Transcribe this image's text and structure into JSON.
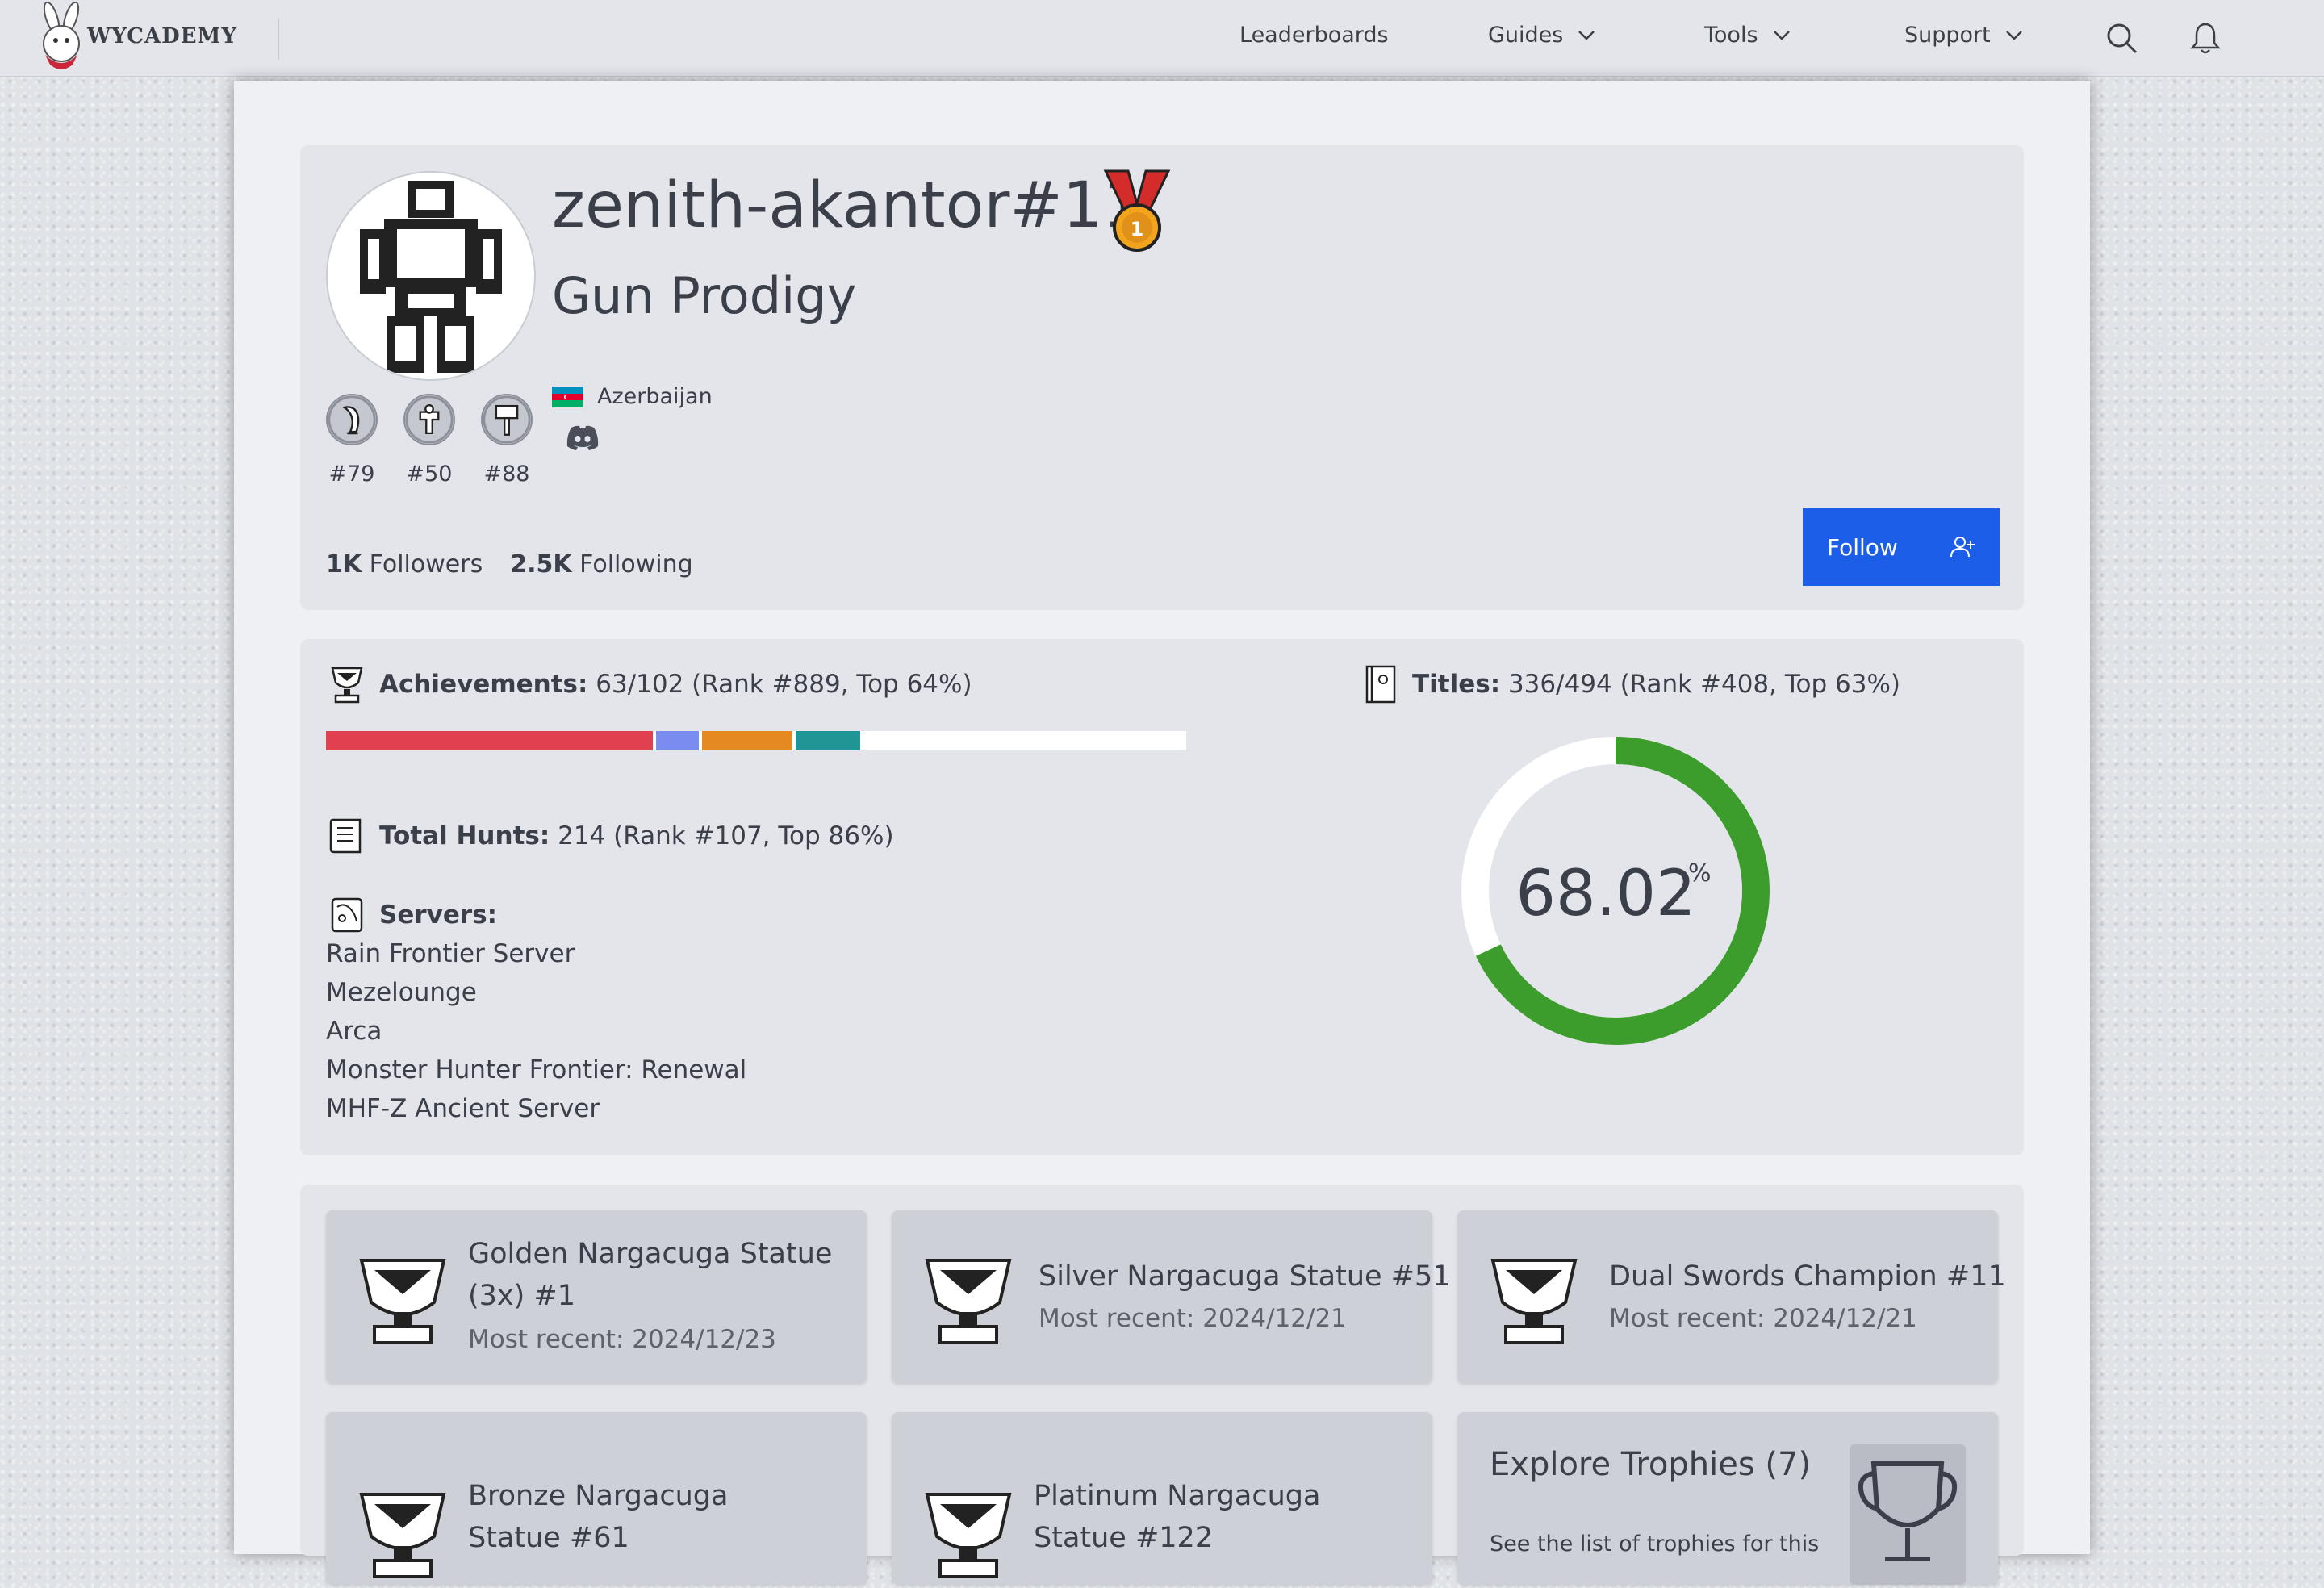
{
  "nav": {
    "brand": "WYCADEMY",
    "items": [
      "Leaderboards",
      "Guides",
      "Tools",
      "Support"
    ]
  },
  "profile": {
    "username": "zenith-akantor#11",
    "title": "Gun Prodigy",
    "weapons": [
      {
        "icon": "great-sword-icon",
        "rank": "#79"
      },
      {
        "icon": "heavy-bowgun-icon",
        "rank": "#50"
      },
      {
        "icon": "hammer-icon",
        "rank": "#88"
      }
    ],
    "country": "Azerbaijan",
    "followers_count": "1K",
    "followers_label": "Followers",
    "following_count": "2.5K",
    "following_label": "Following",
    "follow_label": "Follow"
  },
  "stats": {
    "achievements_label": "Achievements:",
    "achievements_value": "63/102 (Rank #889, Top 64%)",
    "achievement_segments": [
      {
        "color": "#e04050",
        "share": 0.38
      },
      {
        "color": "#7a8cf0",
        "share": 0.05
      },
      {
        "color": "#e48a20",
        "share": 0.105
      },
      {
        "color": "#1f9595",
        "share": 0.075
      }
    ],
    "hunts_label": "Total Hunts:",
    "hunts_value": "214 (Rank #107, Top 86%)",
    "servers_label": "Servers:",
    "servers": [
      "Rain Frontier Server",
      "Mezelounge",
      "Arca",
      "Monster Hunter Frontier: Renewal",
      "MHF-Z Ancient Server"
    ],
    "titles_label": "Titles:",
    "titles_value": "336/494 (Rank #408, Top 63%)",
    "titles_percent": "68.02",
    "titles_fraction": 0.6802,
    "percent_sign": "%",
    "donut_color": "#3c9c2c"
  },
  "trophies": [
    {
      "name": "Golden Nargacuga Statue (3x) #1",
      "date": "Most recent: 2024/12/23"
    },
    {
      "name": "Silver Nargacuga Statue #51",
      "date": "Most recent: 2024/12/21"
    },
    {
      "name": "Dual Swords Champion #11",
      "date": "Most recent: 2024/12/21"
    },
    {
      "name": "Bronze Nargacuga Statue #61",
      "date": ""
    },
    {
      "name": "Platinum Nargacuga Statue #122",
      "date": ""
    }
  ],
  "explore": {
    "title": "Explore Trophies (7)",
    "desc": "See the list of trophies for this"
  }
}
